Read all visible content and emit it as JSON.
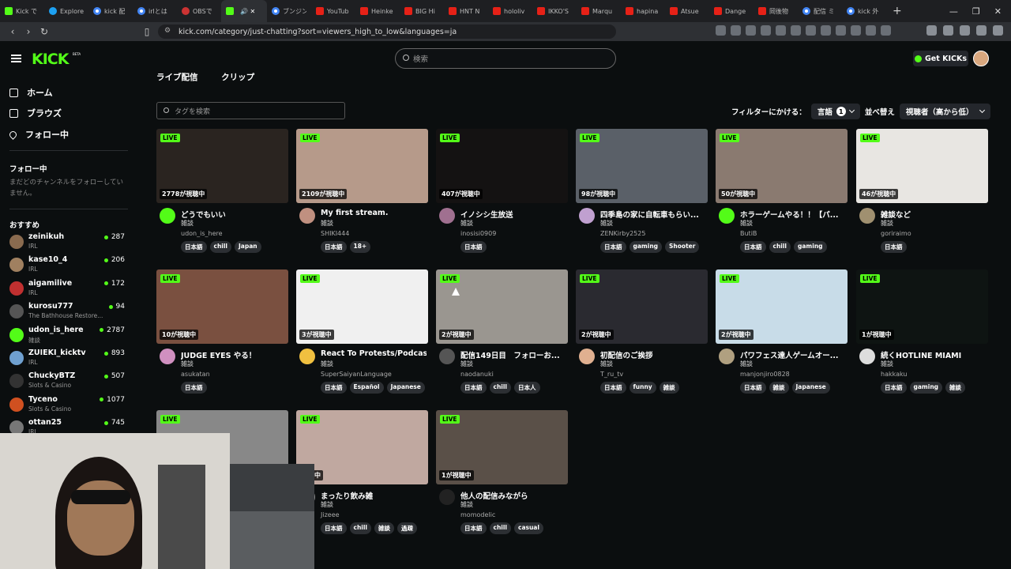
{
  "browser": {
    "tabs": [
      {
        "label": "Kick で",
        "fav": "k"
      },
      {
        "label": "Explore",
        "fav": "x"
      },
      {
        "label": "kick 配",
        "fav": "g"
      },
      {
        "label": "irlとは",
        "fav": "g"
      },
      {
        "label": "OBSで",
        "fav": "o"
      },
      {
        "label": "",
        "fav": "k",
        "active": true
      },
      {
        "label": "ブンジン",
        "fav": "g"
      },
      {
        "label": "YouTub",
        "fav": "yt"
      },
      {
        "label": "Heinke",
        "fav": "yt"
      },
      {
        "label": "BIG Hi",
        "fav": "yt"
      },
      {
        "label": "HNT N",
        "fav": "yt"
      },
      {
        "label": "hololiv",
        "fav": "yt"
      },
      {
        "label": "IKKO'S",
        "fav": "yt"
      },
      {
        "label": "Marqu",
        "fav": "yt"
      },
      {
        "label": "hapina",
        "fav": "yt"
      },
      {
        "label": "Atsue",
        "fav": "yt"
      },
      {
        "label": "Dange",
        "fav": "yt"
      },
      {
        "label": "岡後物",
        "fav": "yt"
      },
      {
        "label": "配信 ミ",
        "fav": "g"
      },
      {
        "label": "kick 外",
        "fav": "g"
      }
    ],
    "url": "kick.com/category/just-chatting?sort=viewers_high_to_low&languages=ja"
  },
  "header": {
    "logo": "KICK",
    "beta": "BETA",
    "search_placeholder": "検索",
    "get_kicks": "Get KICKs"
  },
  "sidebar": {
    "nav": [
      {
        "label": "ホーム",
        "icon": "home-icon"
      },
      {
        "label": "ブラウズ",
        "icon": "browse-icon"
      },
      {
        "label": "フォロー中",
        "icon": "heart-icon"
      }
    ],
    "following_header": "フォロー中",
    "following_note": "まだどのチャンネルをフォローしていません。",
    "recommended_header": "おすすめ",
    "recommended": [
      {
        "name": "zeinikuh",
        "cat": "IRL",
        "viewers": "287",
        "color": "#8a6b4f"
      },
      {
        "name": "kase10_4",
        "cat": "IRL",
        "viewers": "206",
        "color": "#a08060"
      },
      {
        "name": "aigamilive",
        "cat": "IRL",
        "viewers": "172",
        "color": "#c03030"
      },
      {
        "name": "kurosu777",
        "cat": "The Bathhouse Restore...",
        "viewers": "94",
        "color": "#555"
      },
      {
        "name": "udon_is_here",
        "cat": "雑談",
        "viewers": "2787",
        "color": "#53fc18"
      },
      {
        "name": "ZUIEKI_kicktv",
        "cat": "IRL",
        "viewers": "893",
        "color": "#6fa0d0"
      },
      {
        "name": "ChuckyBTZ",
        "cat": "Slots & Casino",
        "viewers": "507",
        "color": "#333"
      },
      {
        "name": "Tyceno",
        "cat": "Slots & Casino",
        "viewers": "1077",
        "color": "#d05020"
      },
      {
        "name": "ottan25",
        "cat": "IRL",
        "viewers": "745",
        "color": "#777"
      }
    ]
  },
  "main": {
    "tabs": [
      "ライブ配信",
      "クリップ"
    ],
    "tag_search_placeholder": "タグを検索",
    "filter_label": "フィルターにかける：",
    "language_label": "言語",
    "language_count": "1",
    "sort_label": "並べ替え",
    "sort_value": "視聴者（高から低）",
    "live_label": "LIVE",
    "cards": [
      {
        "title": "どうでもいい",
        "cat": "雑談",
        "user": "udon_is_here",
        "viewers": "2778が視聴中",
        "tags": [
          "日本語",
          "chill",
          "Japan"
        ],
        "bg": "#2a2420",
        "av": "#53fc18"
      },
      {
        "title": "My first stream.",
        "cat": "雑談",
        "user": "SHIKI444",
        "viewers": "2109が視聴中",
        "tags": [
          "日本語",
          "18+"
        ],
        "bg": "#b69a8a",
        "av": "#c09080"
      },
      {
        "title": "イノシシ生放送",
        "cat": "雑談",
        "user": "inosisi0909",
        "viewers": "407が視聴中",
        "tags": [
          "日本語"
        ],
        "bg": "#141212",
        "av": "#a07090"
      },
      {
        "title": "四季島の家に自転車もらい...",
        "cat": "雑談",
        "user": "ZENKirby2525",
        "viewers": "98が視聴中",
        "tags": [
          "日本語",
          "gaming",
          "Shooter"
        ],
        "bg": "#5a6068",
        "av": "#c0a0d0"
      },
      {
        "title": "ホラーゲームやる！！【パ...",
        "cat": "雑談",
        "user": "ButiB",
        "viewers": "50が視聴中",
        "tags": [
          "日本語",
          "chill",
          "gaming"
        ],
        "bg": "#8a7a70",
        "av": "#53fc18"
      },
      {
        "title": "雑談など",
        "cat": "雑談",
        "user": "goriraimo",
        "viewers": "46が視聴中",
        "tags": [
          "日本語"
        ],
        "bg": "#e8e6e2",
        "av": "#a09070"
      },
      {
        "title": "JUDGE EYES やる！",
        "cat": "雑談",
        "user": "asukatan",
        "viewers": "10が視聴中",
        "tags": [
          "日本語"
        ],
        "bg": "#7a5040",
        "av": "#d090c0"
      },
      {
        "title": "React To Protests/Podcas...",
        "cat": "雑談",
        "user": "SuperSaiyanLanguage",
        "viewers": "3が視聴中",
        "tags": [
          "日本語",
          "Español",
          "Japanese"
        ],
        "bg": "#f0f0f0",
        "av": "#f0c040"
      },
      {
        "title": "配信149日目　フォローお...",
        "cat": "雑談",
        "user": "naodanuki",
        "viewers": "2が視聴中",
        "tags": [
          "日本語",
          "chill",
          "日本人"
        ],
        "bg": "#9a9690",
        "av": "#555"
      },
      {
        "title": "初配信のご挨拶",
        "cat": "雑談",
        "user": "T_ru_tv",
        "viewers": "2が視聴中",
        "tags": [
          "日本語",
          "funny",
          "雑談"
        ],
        "bg": "#2a2a30",
        "av": "#e0b090"
      },
      {
        "title": "パワフェス達人ゲームオー...",
        "cat": "雑談",
        "user": "manjonjiro0828",
        "viewers": "2が視聴中",
        "tags": [
          "日本語",
          "雑談",
          "Japanese"
        ],
        "bg": "#c8dce8",
        "av": "#b0a080"
      },
      {
        "title": "続くHOTLINE MIAMI",
        "cat": "雑談",
        "user": "hakkaku",
        "viewers": "1が視聴中",
        "tags": [
          "日本語",
          "gaming",
          "雑談"
        ],
        "bg": "#0e1412",
        "av": "#ddd"
      },
      {
        "title": "",
        "cat": "",
        "user": "",
        "viewers": "",
        "tags": [],
        "bg": "#888",
        "av": "#888"
      },
      {
        "title": "まったり飲み雑",
        "cat": "雑談",
        "user": "Jizeee",
        "viewers": "視聴中",
        "tags": [
          "日本語",
          "chill",
          "雑談",
          "過疎"
        ],
        "bg": "#c0a8a0",
        "av": "#888"
      },
      {
        "title": "他人の配信みながら",
        "cat": "雑談",
        "user": "momodelic",
        "viewers": "1が視聴中",
        "tags": [
          "日本語",
          "chill",
          "casual"
        ],
        "bg": "#5a5048",
        "av": "#222"
      }
    ]
  }
}
